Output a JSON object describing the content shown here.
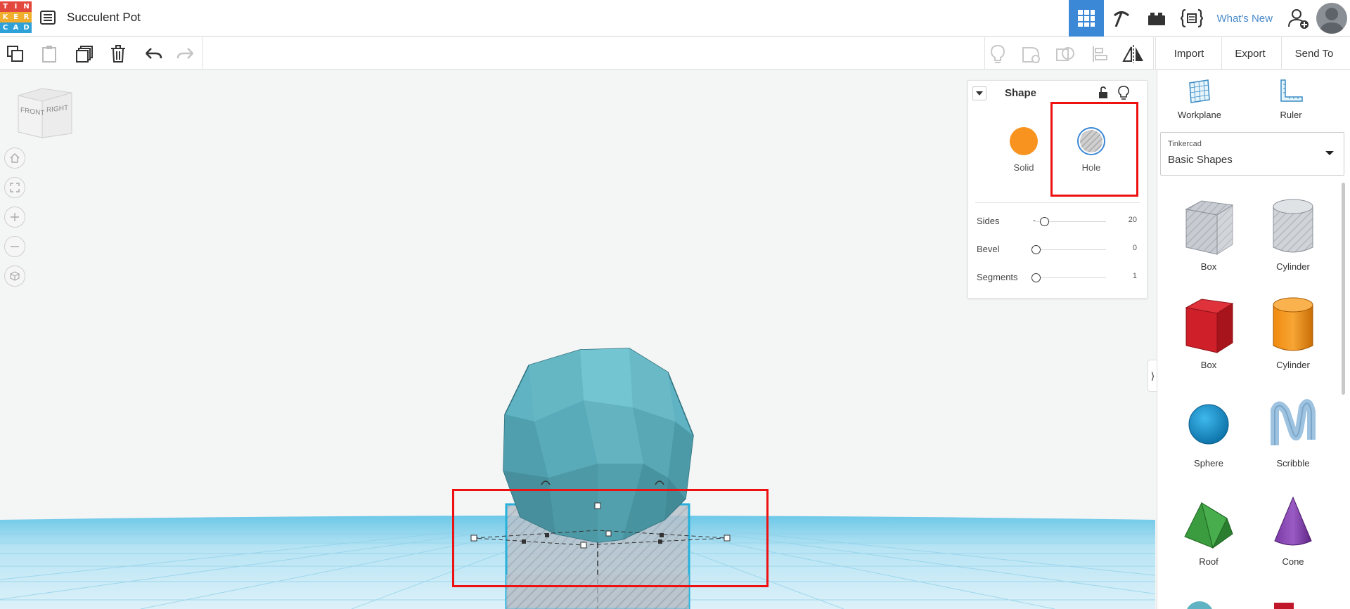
{
  "logo": {
    "letters": [
      "T",
      "I",
      "N",
      "K",
      "E",
      "R",
      "C",
      "A",
      "D"
    ],
    "colors": [
      "#e2483d",
      "#e2483d",
      "#e2483d",
      "#f0ad2e",
      "#f0ad2e",
      "#f0ad2e",
      "#2ea1d8",
      "#2ea1d8",
      "#2ea1d8"
    ]
  },
  "header": {
    "design_title": "Succulent Pot",
    "nav_icons": [
      "grid-icon",
      "pickaxe-icon",
      "brick-icon",
      "codeblocks-icon"
    ],
    "whats_new": "What's New"
  },
  "toolbar": {
    "left_icons": [
      "copy-icon",
      "paste-icon",
      "duplicate-icon",
      "delete-icon",
      "undo-icon",
      "redo-icon"
    ],
    "right_icons": [
      "show-all-icon",
      "group-icon",
      "ungroup-icon",
      "align-icon",
      "mirror-icon"
    ],
    "import_label": "Import",
    "export_label": "Export",
    "send_to_label": "Send To"
  },
  "view_cube": {
    "front": "FRONT",
    "right": "RIGHT"
  },
  "shape_panel": {
    "title": "Shape",
    "solid_label": "Solid",
    "hole_label": "Hole",
    "solid_color": "#f7931e",
    "selected_type": "Hole",
    "properties": [
      {
        "label": "Sides",
        "value": "20",
        "slider_fraction": 0.11
      },
      {
        "label": "Bevel",
        "value": "0",
        "slider_fraction": 0
      },
      {
        "label": "Segments",
        "value": "1",
        "slider_fraction": 0
      }
    ]
  },
  "right_panel": {
    "workplane_label": "Workplane",
    "ruler_label": "Ruler",
    "library_small": "Tinkercad",
    "library_name": "Basic Shapes",
    "shapes": [
      {
        "label": "Box"
      },
      {
        "label": "Cylinder"
      },
      {
        "label": "Box"
      },
      {
        "label": "Cylinder"
      },
      {
        "label": "Sphere"
      },
      {
        "label": "Scribble"
      },
      {
        "label": "Roof"
      },
      {
        "label": "Cone"
      }
    ]
  },
  "colors": {
    "accent_blue": "#3b88d6",
    "highlight_red": "#ee1111",
    "solid_orange": "#f7931e",
    "shape_teal": "#5fb3c2"
  }
}
